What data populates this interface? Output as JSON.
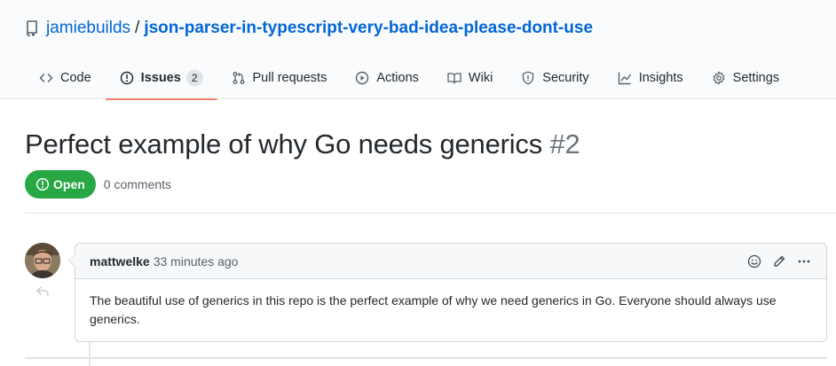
{
  "repo": {
    "owner": "jamiebuilds",
    "separator": "/",
    "name": "json-parser-in-typescript-very-bad-idea-please-dont-use"
  },
  "tabs": [
    {
      "label": "Code",
      "icon": "code-icon",
      "selected": false
    },
    {
      "label": "Issues",
      "icon": "issue-opened-icon",
      "selected": true,
      "counter": "2"
    },
    {
      "label": "Pull requests",
      "icon": "git-pull-request-icon",
      "selected": false
    },
    {
      "label": "Actions",
      "icon": "play-icon",
      "selected": false
    },
    {
      "label": "Wiki",
      "icon": "book-icon",
      "selected": false
    },
    {
      "label": "Security",
      "icon": "shield-icon",
      "selected": false
    },
    {
      "label": "Insights",
      "icon": "graph-icon",
      "selected": false
    },
    {
      "label": "Settings",
      "icon": "gear-icon",
      "selected": false
    }
  ],
  "issue": {
    "title": "Perfect example of why Go needs generics",
    "number": "#2",
    "state": "Open",
    "comment_count": "0 comments"
  },
  "comment": {
    "author": "mattwelke",
    "timestamp": "33 minutes ago",
    "body": "The beautiful use of generics in this repo is the perfect example of why we need generics in Go. Everyone should always use generics."
  },
  "colors": {
    "link": "#0366d6",
    "open_state": "#28a745",
    "selected_tab_underline": "#f9826c",
    "border": "#e1e4e8"
  }
}
